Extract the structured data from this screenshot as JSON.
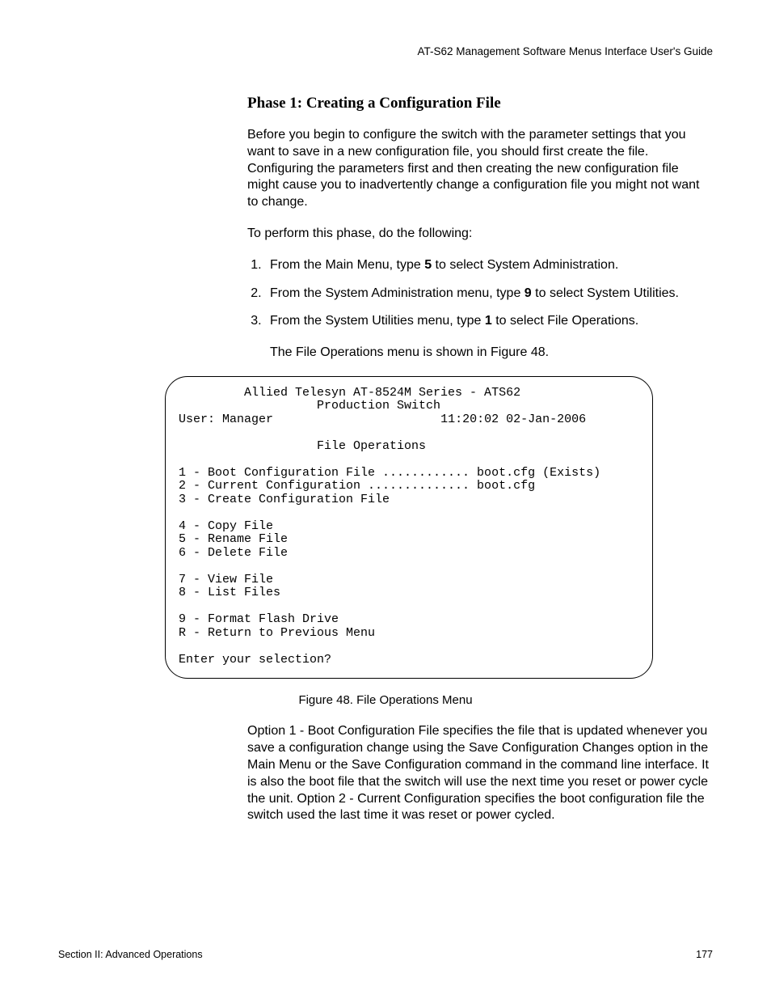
{
  "header": "AT-S62 Management Software Menus Interface User's Guide",
  "subheading": "Phase 1: Creating a Configuration File",
  "para1": "Before you begin to configure the switch with the parameter settings that you want to save in a new configuration file, you should first create the file. Configuring the parameters first and then creating the new configuration file might cause you to inadvertently change a configuration file you might not want to change.",
  "para2": "To perform this phase, do the following:",
  "steps": {
    "s1a": "From the Main Menu, type ",
    "s1b": "5",
    "s1c": " to select System Administration.",
    "s2a": "From the System Administration menu, type ",
    "s2b": "9",
    "s2c": " to select System Utilities.",
    "s3a": "From the System Utilities menu, type ",
    "s3b": "1",
    "s3c": " to select File Operations."
  },
  "note_after_steps": "The File Operations menu is shown in Figure 48.",
  "menu": {
    "line1": "         Allied Telesyn AT-8524M Series - ATS62",
    "line2": "                   Production Switch",
    "line3_left": "User: Manager",
    "line3_right": "11:20:02 02-Jan-2006",
    "line4": "                   File Operations",
    "m1": "1 - Boot Configuration File ............ boot.cfg (Exists)",
    "m2": "2 - Current Configuration .............. boot.cfg",
    "m3": "3 - Create Configuration File",
    "m4": "4 - Copy File",
    "m5": "5 - Rename File",
    "m6": "6 - Delete File",
    "m7": "7 - View File",
    "m8": "8 - List Files",
    "m9": "9 - Format Flash Drive",
    "mR": "R - Return to Previous Menu",
    "prompt": "Enter your selection?"
  },
  "figure_caption": "Figure 48. File Operations Menu",
  "para3": "Option 1 - Boot Configuration File specifies the file that is updated whenever you save a configuration change using the Save Configuration Changes option in the Main Menu or the Save Configuration command in the command line interface. It is also the boot file that the switch will use the next time you reset or power cycle the unit. Option 2 - Current Configuration specifies the boot configuration file the switch used the last time it was reset or power cycled.",
  "footer_left": "Section II: Advanced Operations",
  "footer_right": "177"
}
